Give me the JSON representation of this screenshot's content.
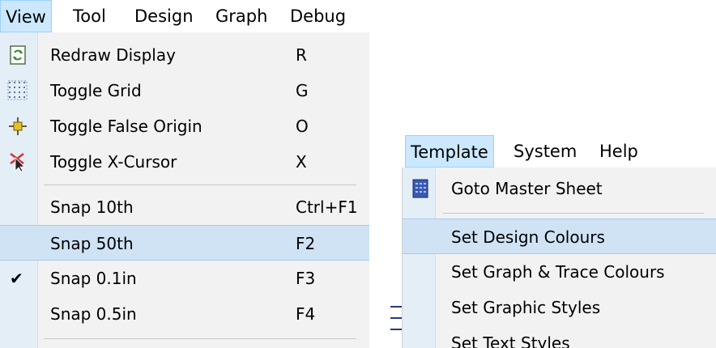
{
  "view_panel": {
    "menubar": [
      "View",
      "Tool",
      "Design",
      "Graph",
      "Debug"
    ],
    "active_menu": "View",
    "items_group1": [
      {
        "label": "Redraw Display",
        "shortcut": "R",
        "icon": "redraw-icon"
      },
      {
        "label": "Toggle Grid",
        "shortcut": "G",
        "icon": "grid-icon"
      },
      {
        "label": "Toggle False Origin",
        "shortcut": "O",
        "icon": "origin-icon"
      },
      {
        "label": "Toggle X-Cursor",
        "shortcut": "X",
        "icon": "x-cursor-icon"
      }
    ],
    "items_group2": [
      {
        "label": "Snap 10th",
        "shortcut": "Ctrl+F1",
        "checked": false,
        "highlighted": false
      },
      {
        "label": "Snap 50th",
        "shortcut": "F2",
        "checked": false,
        "highlighted": true
      },
      {
        "label": "Snap 0.1in",
        "shortcut": "F3",
        "checked": true,
        "highlighted": false
      },
      {
        "label": "Snap 0.5in",
        "shortcut": "F4",
        "checked": false,
        "highlighted": false
      }
    ],
    "check_glyph": "✔"
  },
  "template_panel": {
    "menubar": [
      "Template",
      "System",
      "Help"
    ],
    "active_menu": "Template",
    "items_group1": [
      {
        "label": "Goto Master Sheet",
        "icon": "sheet-icon"
      }
    ],
    "items_group2": [
      {
        "label": "Set Design Colours",
        "highlighted": true
      },
      {
        "label": "Set Graph & Trace Colours",
        "highlighted": false
      },
      {
        "label": "Set Graphic Styles",
        "highlighted": false
      },
      {
        "label": "Set Text Styles",
        "highlighted": false
      }
    ]
  },
  "colors": {
    "highlight": "#cfe3f5",
    "menu_active": "#cce8ff",
    "gutter": "#e4eef7"
  }
}
